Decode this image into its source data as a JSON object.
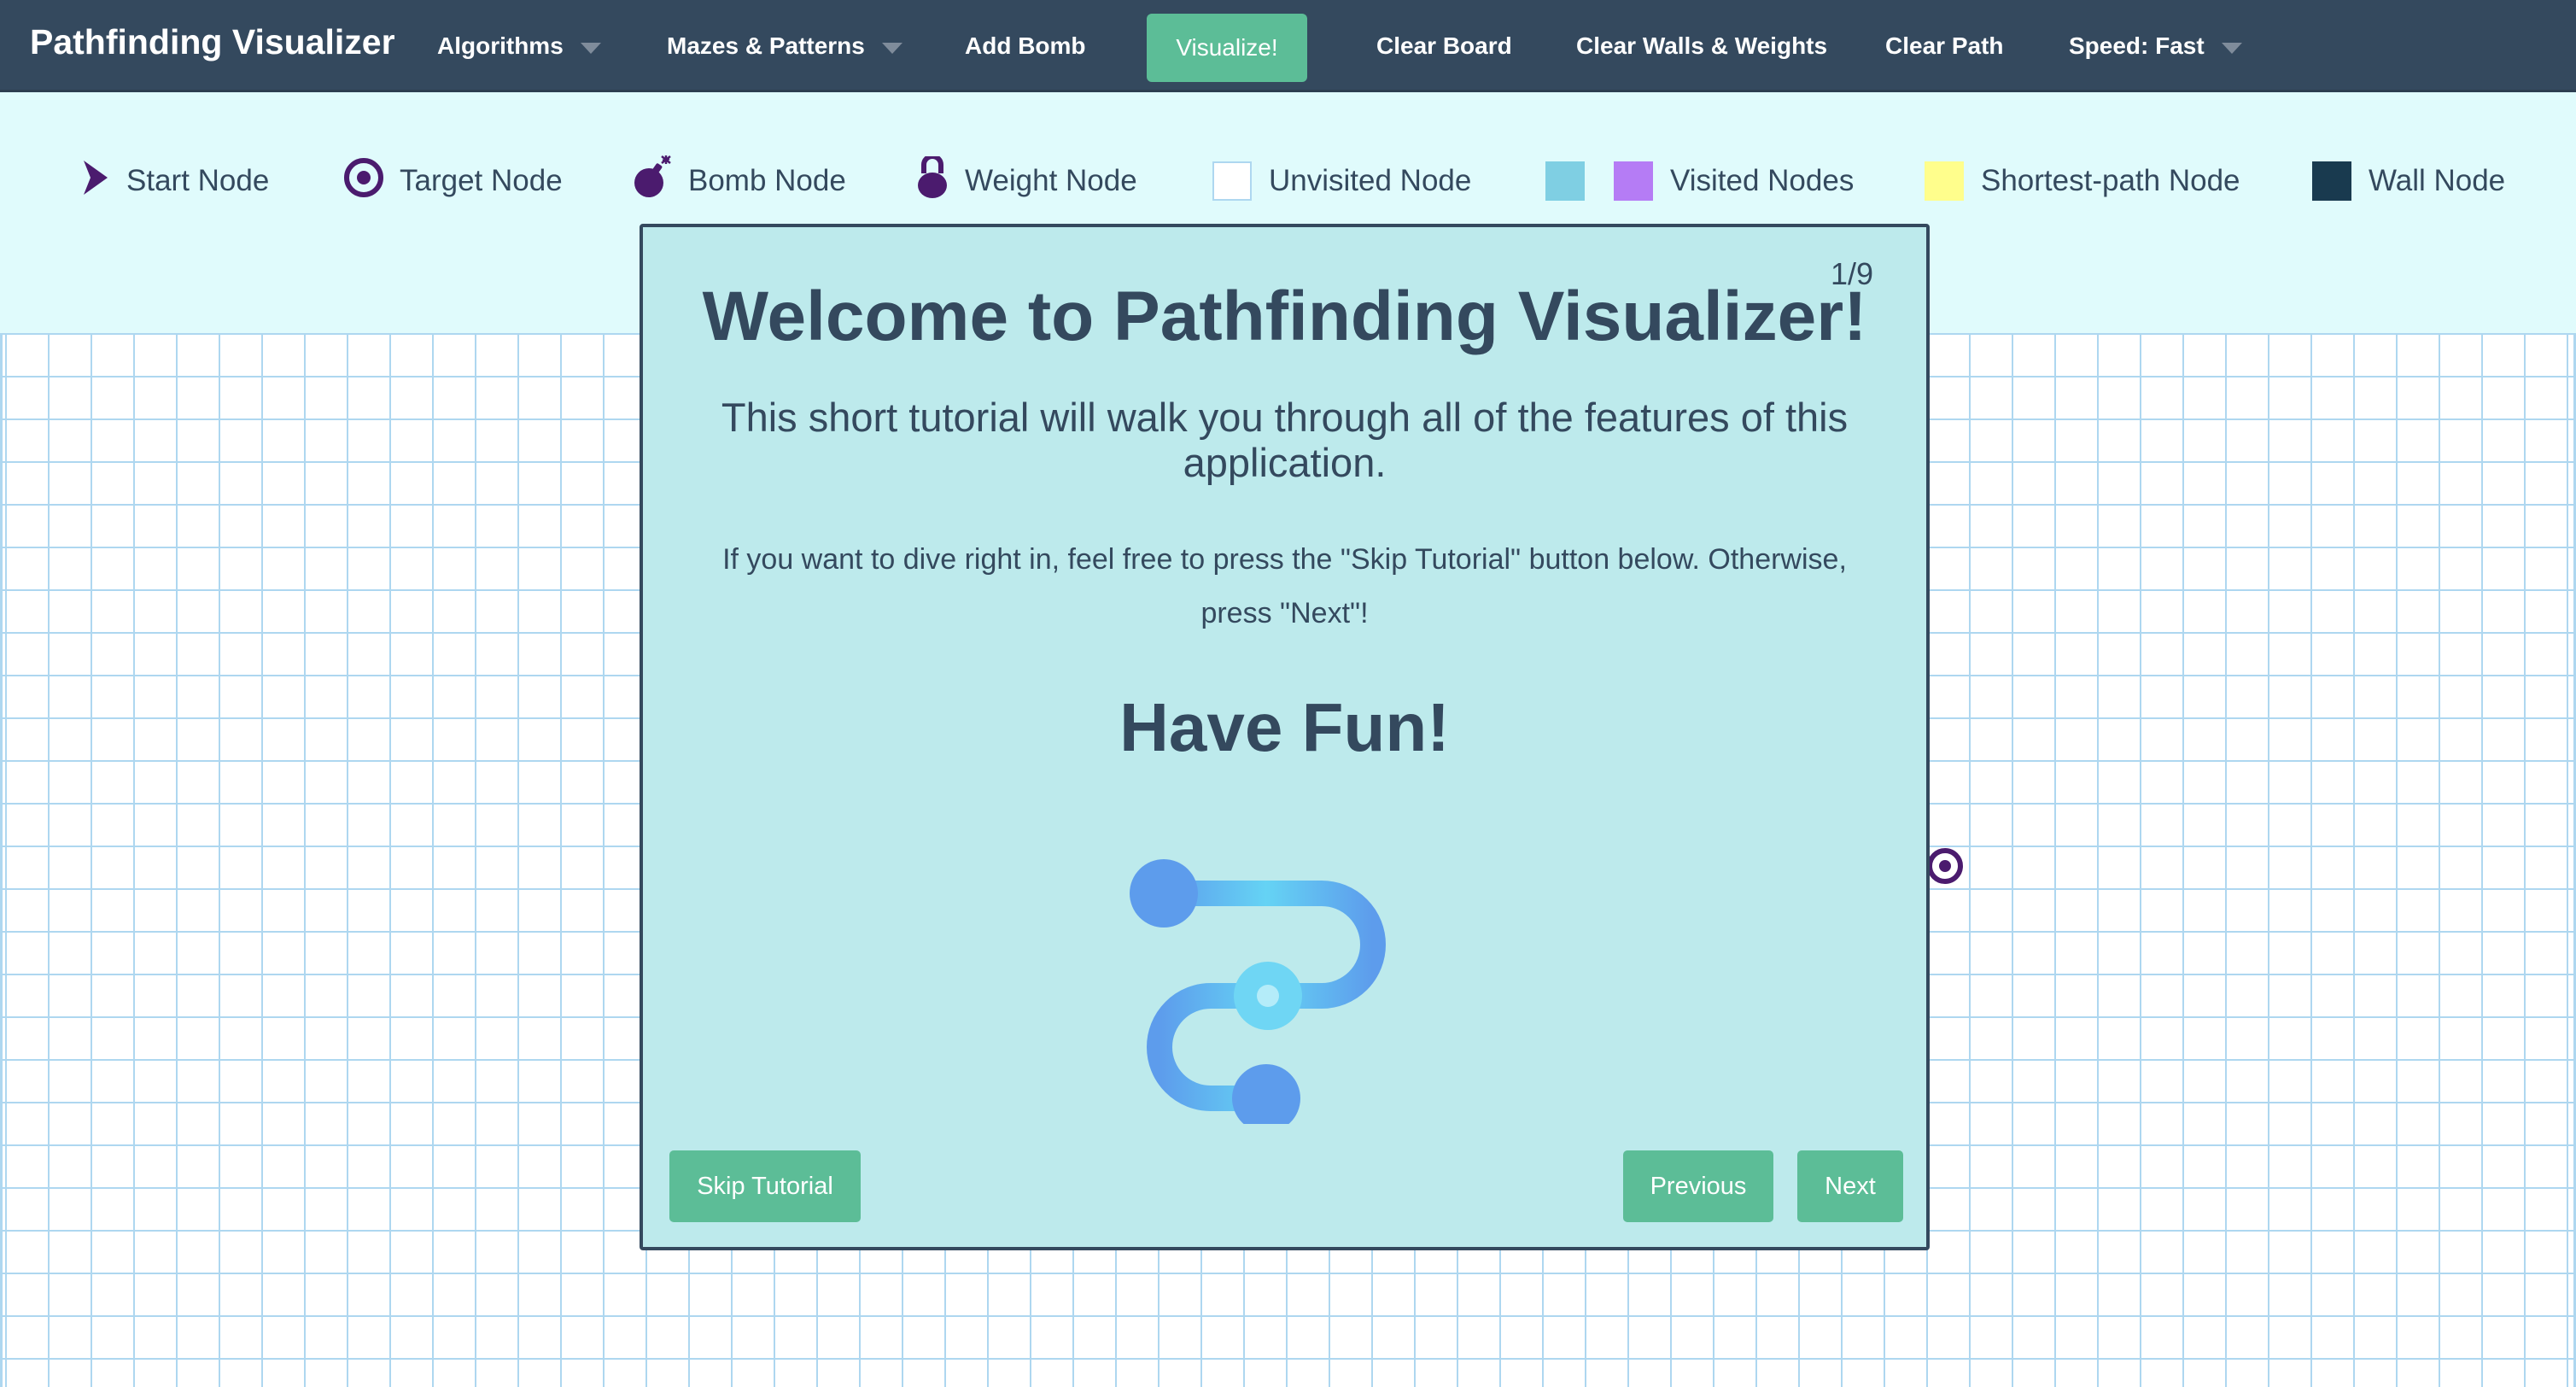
{
  "navbar": {
    "brand": "Pathfinding Visualizer",
    "algorithms": "Algorithms",
    "mazes": "Mazes & Patterns",
    "add_bomb": "Add Bomb",
    "visualize": "Visualize!",
    "clear_board": "Clear Board",
    "clear_walls": "Clear Walls & Weights",
    "clear_path": "Clear Path",
    "speed": "Speed: Fast"
  },
  "legend": {
    "start": "Start Node",
    "target": "Target Node",
    "bomb": "Bomb Node",
    "weight": "Weight Node",
    "unvisited": "Unvisited Node",
    "visited": "Visited Nodes",
    "shortest": "Shortest-path Node",
    "wall": "Wall Node"
  },
  "colors": {
    "navbar": "#34495e",
    "accent_button": "#5cbd97",
    "legend_bg": "#e0fbfc",
    "modal_bg": "#bdeaec",
    "node_icon": "#4b1b6e",
    "visited_blue": "#7fcfe3",
    "visited_purple": "#b57cf5",
    "shortest_path": "#fffe8c",
    "wall": "#193a4f",
    "grid_line": "#aed7f0"
  },
  "icons": {
    "start": "chevron-right-icon",
    "target": "bullseye-icon",
    "bomb": "bomb-icon",
    "weight": "kettlebell-icon",
    "tutorial": "route-icon"
  },
  "tutorial": {
    "counter": "1/9",
    "title": "Welcome to Pathfinding Visualizer!",
    "subtitle": "This short tutorial will walk you through all of the features of this application.",
    "description": "If you want to dive right in, feel free to press the \"Skip Tutorial\" button below. Otherwise, press \"Next\"!",
    "fun": "Have Fun!",
    "skip": "Skip Tutorial",
    "previous": "Previous",
    "next": "Next"
  }
}
